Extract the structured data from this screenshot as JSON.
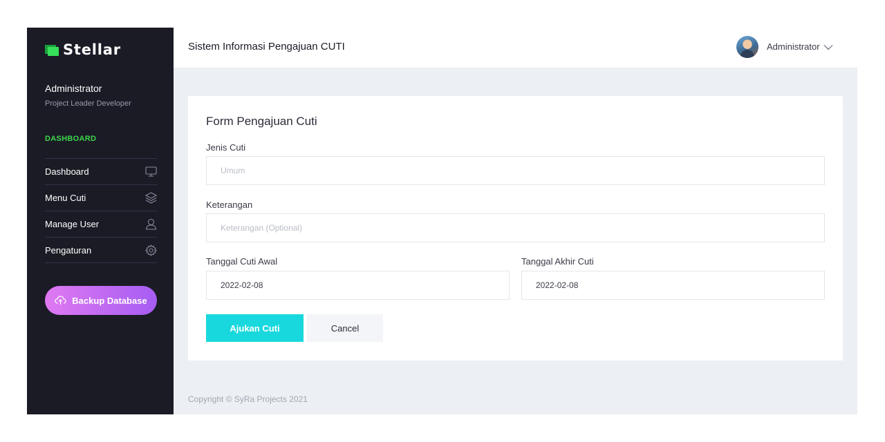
{
  "sidebar": {
    "brand": "Stellar",
    "user_name": "Administrator",
    "user_role": "Project Leader Developer",
    "section_title": "DASHBOARD",
    "items": [
      {
        "label": "Dashboard",
        "icon": "monitor-icon"
      },
      {
        "label": "Menu Cuti",
        "icon": "layers-icon"
      },
      {
        "label": "Manage User",
        "icon": "user-icon"
      },
      {
        "label": "Pengaturan",
        "icon": "gear-icon"
      }
    ],
    "backup_label": "Backup Database"
  },
  "header": {
    "title": "Sistem Informasi Pengajuan CUTI",
    "profile_name": "Administrator"
  },
  "form": {
    "title": "Form Pengajuan Cuti",
    "jenis_label": "Jenis Cuti",
    "jenis_placeholder": "Umum",
    "keterangan_label": "Keterangan",
    "keterangan_placeholder": "Keterangan (Optional)",
    "tanggal_awal_label": "Tanggal Cuti Awal",
    "tanggal_awal_value": "2022-02-08",
    "tanggal_akhir_label": "Tanggal Akhir Cuti",
    "tanggal_akhir_value": "2022-02-08",
    "submit_label": "Ajukan Cuti",
    "cancel_label": "Cancel"
  },
  "footer": {
    "text": "Copyright © SyRa Projects 2021"
  },
  "colors": {
    "sidebar_bg": "#1b1b26",
    "accent_green": "#3dd64a",
    "primary_button": "#19d8dd",
    "backup_gradient_start": "#e079f2",
    "backup_gradient_end": "#a55df2",
    "content_bg": "#eceff4"
  }
}
